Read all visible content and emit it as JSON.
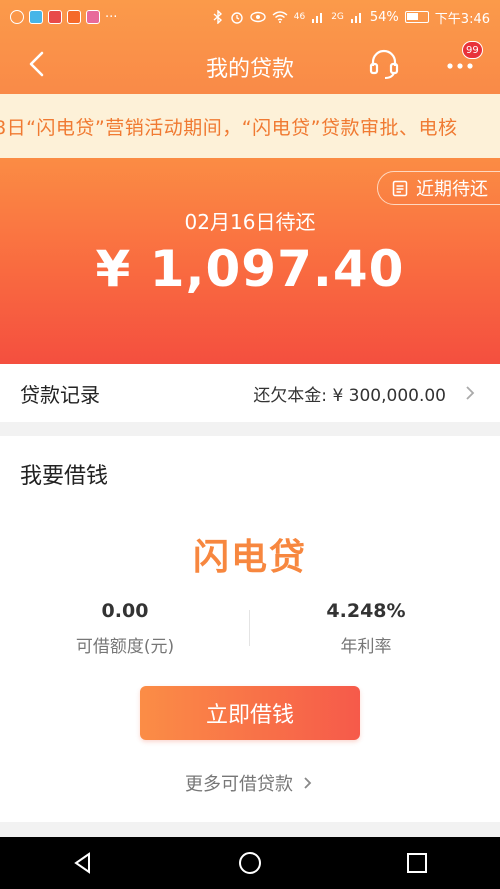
{
  "status_bar": {
    "signal1": "46",
    "signal2": "2G",
    "battery": "54%",
    "time": "下午3:46"
  },
  "header": {
    "title": "我的贷款",
    "badge_count": "99"
  },
  "notice": {
    "text": "8日“闪电贷”营销活动期间，“闪电贷”贷款审批、电核"
  },
  "hero": {
    "recent_label": "近期待还",
    "due_date": "02月16日待还",
    "amount": "¥ 1,097.40"
  },
  "record": {
    "label": "贷款记录",
    "value": "还欠本金: ¥  300,000.00"
  },
  "borrow": {
    "title": "我要借钱",
    "product": "闪电贷",
    "limit_value": "0.00",
    "limit_label": "可借额度(元)",
    "rate_value": "4.248%",
    "rate_label": "年利率",
    "button_label": "立即借钱",
    "more_label": "更多可借贷款"
  },
  "colors": {
    "accent": "#f98a48",
    "product": "#f7873f",
    "badge": "#e8323a"
  }
}
